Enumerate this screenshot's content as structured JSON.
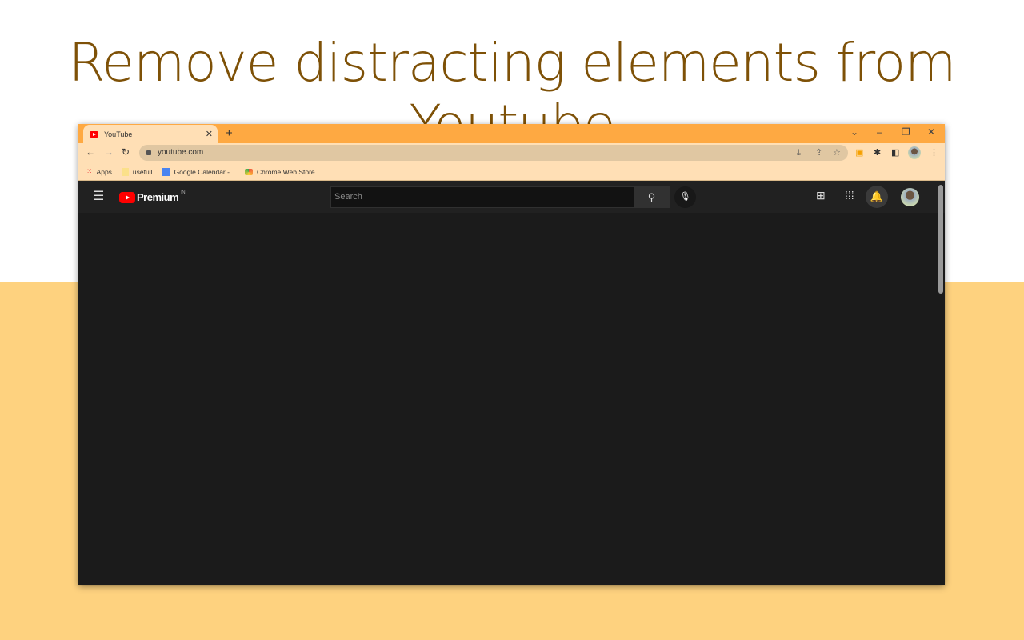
{
  "headline": "Remove distracting elements from Youtube",
  "browser": {
    "tab_title": "YouTube",
    "url": "youtube.com",
    "bookmarks": [
      {
        "label": "Apps"
      },
      {
        "label": "usefull"
      },
      {
        "label": "Google Calendar -..."
      },
      {
        "label": "Chrome Web Store..."
      }
    ]
  },
  "youtube": {
    "logo_text": "Premium",
    "region": "IN",
    "search_placeholder": "Search"
  },
  "colors": {
    "tab_bar": "#fea942",
    "toolbar": "#ffdfb5",
    "headline": "#7e5107",
    "background_bottom": "#fed27f",
    "youtube_bg": "#1b1b1b"
  }
}
